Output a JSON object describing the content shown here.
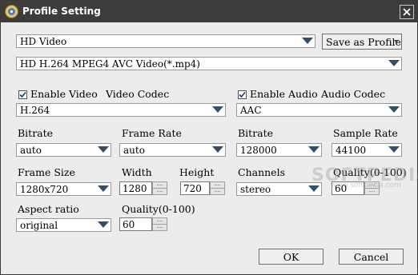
{
  "window": {
    "title": "Profile Setting"
  },
  "profile": {
    "category": "HD Video",
    "save_as_profile": "Save as Profile",
    "format": "HD H.264 MPEG4 AVC Video(*.mp4)"
  },
  "video": {
    "enable_label": "Enable Video",
    "enabled": true,
    "codec_label": "Video Codec",
    "codec": "H.264",
    "bitrate_label": "Bitrate",
    "bitrate": "auto",
    "frame_rate_label": "Frame Rate",
    "frame_rate": "auto",
    "frame_size_label": "Frame Size",
    "frame_size": "1280x720",
    "width_label": "Width",
    "width": "1280",
    "height_label": "Height",
    "height": "720",
    "aspect_ratio_label": "Aspect ratio",
    "aspect_ratio": "original",
    "quality_label": "Quality(0-100)",
    "quality": "60"
  },
  "audio": {
    "enable_label": "Enable Audio",
    "enabled": true,
    "codec_label": "Audio Codec",
    "codec": "AAC",
    "bitrate_label": "Bitrate",
    "bitrate": "128000",
    "sample_rate_label": "Sample Rate",
    "sample_rate": "44100",
    "channels_label": "Channels",
    "channels": "stereo",
    "quality_label": "Quality(0-100)",
    "quality": "60"
  },
  "buttons": {
    "ok": "OK",
    "cancel": "Cancel"
  },
  "watermark": {
    "text": "SOFTPEDIA",
    "url": "www.softpedia.com"
  }
}
